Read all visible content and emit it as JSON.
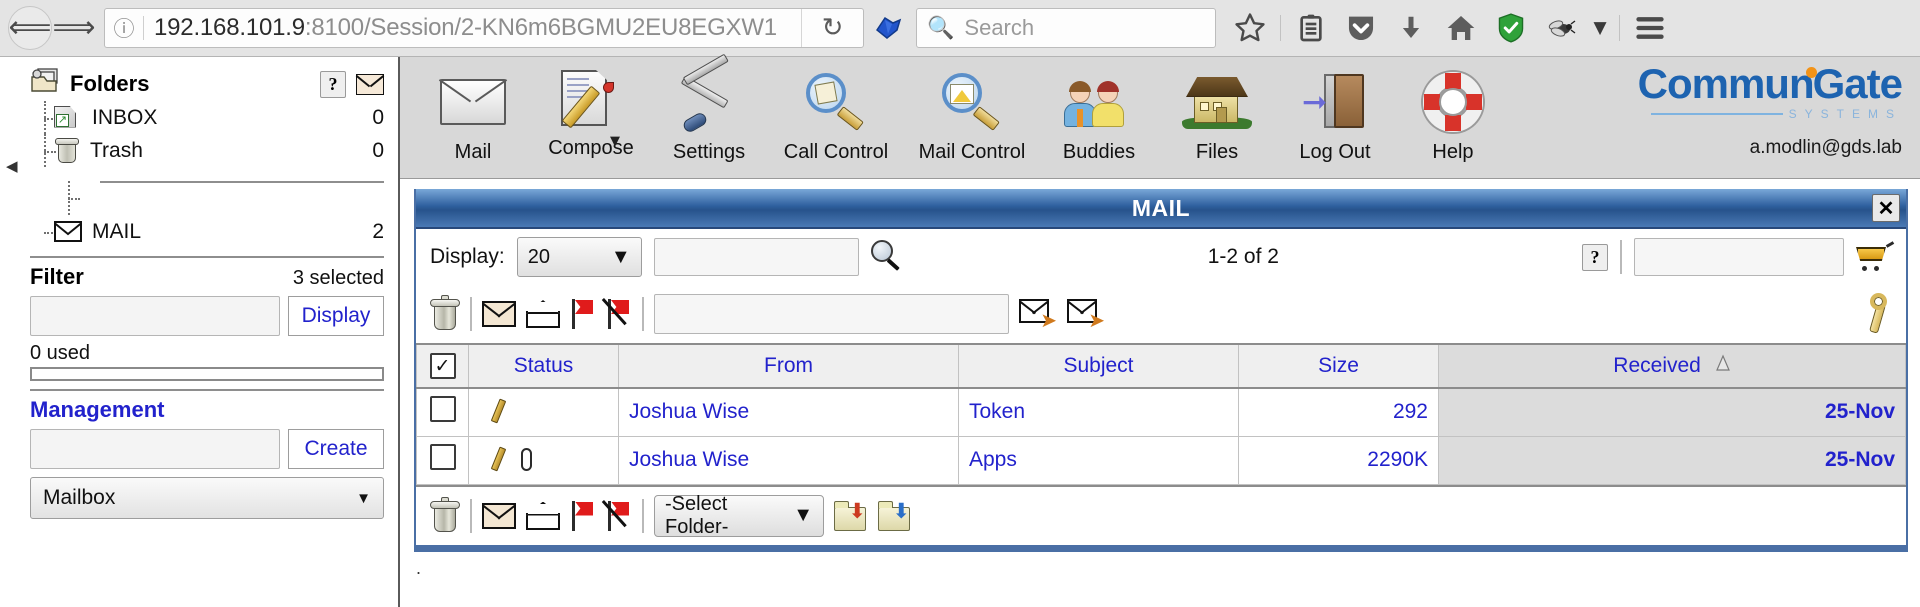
{
  "browser": {
    "back_label": "Back",
    "forward_label": "Forward",
    "identity_icon": "info-circle-icon",
    "url_host": "192.168.101.9",
    "url_path": ":8100/Session/2-KN6m6BGMU2EU8EGXW1",
    "url_full": "192.168.101.9:8100/Session/2-KN6m6BGMU2EU8EGXW1",
    "reload_label": "Reload",
    "search_placeholder": "Search",
    "icons": {
      "bookmark": "star-icon",
      "reader": "library-icon",
      "pocket": "pocket-shield-icon",
      "download": "download-arrow-icon",
      "home": "home-icon",
      "shield": "shield-check-icon",
      "bug": "bug-icon",
      "bug_dropdown": "chevron-down-icon",
      "menu": "hamburger-menu-icon"
    }
  },
  "sidebar": {
    "header": {
      "title": "Folders",
      "help_label": "?",
      "mail_icon": "envelope-icon"
    },
    "folders": [
      {
        "name": "INBOX",
        "count": "0",
        "icon": "inbox-folder-icon"
      },
      {
        "name": "Trash",
        "count": "0",
        "icon": "trash-icon"
      }
    ],
    "mail_folder": {
      "name": "MAIL",
      "count": "2",
      "icon": "envelope-icon"
    },
    "filter": {
      "title": "Filter",
      "selected_note": "3 selected",
      "input_value": "",
      "display_button": "Display",
      "used_label": "0 used",
      "used_percent": 0
    },
    "management": {
      "title": "Management",
      "input_value": "",
      "create_button": "Create",
      "type_selected": "Mailbox"
    },
    "collapse_icon": "collapse-left-arrow-icon"
  },
  "cg_toolbar": {
    "items": [
      {
        "label": "Mail",
        "icon": "mail-envelope-icon"
      },
      {
        "label": "Compose",
        "icon": "compose-pencil-icon"
      },
      {
        "label": "Settings",
        "icon": "tools-wrench-screwdriver-icon"
      },
      {
        "label": "Call Control",
        "icon": "call-control-magnifier-icon"
      },
      {
        "label": "Mail Control",
        "icon": "mail-control-magnifier-icon"
      },
      {
        "label": "Buddies",
        "icon": "buddies-people-icon"
      },
      {
        "label": "Files",
        "icon": "files-house-icon"
      },
      {
        "label": "Log Out",
        "icon": "logout-door-icon"
      },
      {
        "label": "Help",
        "icon": "help-lifering-icon"
      }
    ],
    "brand": {
      "name_part1": "Commun",
      "name_part2": "Gate",
      "tagline": "SYSTEMS",
      "user_email": "a.modlin@gds.lab"
    }
  },
  "mail_window": {
    "title": "MAIL",
    "close_label": "✕",
    "display_row": {
      "label": "Display:",
      "page_size": "20",
      "search_value": "",
      "search_icon": "magnifier-icon",
      "counter": "1-2 of 2",
      "help_label": "?",
      "right_input_value": "",
      "cart_icon": "basket-icon"
    },
    "actions_top": {
      "delete_icon": "trash-icon",
      "mark_read_icon": "envelope-closed-icon",
      "mark_unread_icon": "envelope-open-icon",
      "flag_icon": "flag-icon",
      "unflag_icon": "flag-off-icon",
      "input_value": "",
      "redirect_icon": "envelope-forward-icon",
      "forward_icon": "envelope-forward-alt-icon",
      "wrench_icon": "wrench-icon"
    },
    "table": {
      "select_all_checked": true,
      "columns": [
        "",
        "Status",
        "From",
        "Subject",
        "Size",
        "Received"
      ],
      "sort_column": "Received",
      "sort_direction": "ascending",
      "rows": [
        {
          "checked": false,
          "status_icons": [
            "pencil-icon"
          ],
          "from": "Joshua Wise",
          "subject": "Token",
          "size": "292",
          "received": "25-Nov"
        },
        {
          "checked": false,
          "status_icons": [
            "pencil-icon",
            "paperclip-icon"
          ],
          "from": "Joshua Wise",
          "subject": "Apps",
          "size": "2290K",
          "received": "25-Nov"
        }
      ]
    },
    "actions_bottom": {
      "delete_icon": "trash-icon",
      "mark_read_icon": "envelope-closed-icon",
      "mark_unread_icon": "envelope-open-icon",
      "flag_icon": "flag-icon",
      "unflag_icon": "flag-off-icon",
      "folder_select": "-Select Folder-",
      "copy_icon": "folder-copy-icon",
      "move_icon": "folder-move-icon"
    }
  },
  "colors": {
    "link_blue": "#2222cc",
    "title_bar_blue": "#2e5f9e",
    "brand_blue": "#1d63b0",
    "brand_orange": "#f29318",
    "selected_col_bg": "#dcdcdc"
  }
}
